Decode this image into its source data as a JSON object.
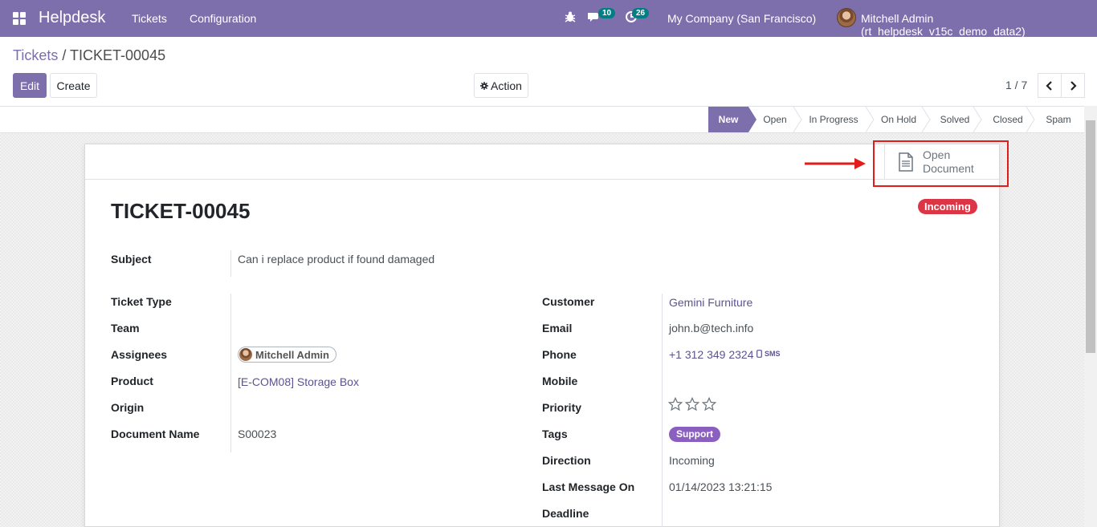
{
  "navbar": {
    "app_name": "Helpdesk",
    "menus": [
      "Tickets",
      "Configuration"
    ],
    "messages_count": "10",
    "activities_count": "26",
    "company": "My Company (San Francisco)",
    "user": "Mitchell Admin (rt_helpdesk_v15c_demo_data2)",
    "color": "#7C6FAB"
  },
  "control": {
    "breadcrumb_parent": "Tickets",
    "breadcrumb_sep": " / ",
    "breadcrumb_current": "TICKET-00045",
    "edit_label": "Edit",
    "create_label": "Create",
    "action_label": "Action",
    "pager": "1 / 7"
  },
  "stages": [
    {
      "label": "New",
      "active": true
    },
    {
      "label": "Open",
      "active": false
    },
    {
      "label": "In Progress",
      "active": false
    },
    {
      "label": "On Hold",
      "active": false
    },
    {
      "label": "Solved",
      "active": false
    },
    {
      "label": "Closed",
      "active": false
    },
    {
      "label": "Spam",
      "active": false
    }
  ],
  "smart_button": {
    "line1": "Open",
    "line2": "Document",
    "icon": "document-icon"
  },
  "form": {
    "title": "TICKET-00045",
    "direction_badge": "Incoming",
    "subject_label": "Subject",
    "subject_value": "Can i replace product if found damaged",
    "left": [
      {
        "label": "Ticket Type",
        "value": ""
      },
      {
        "label": "Team",
        "value": ""
      },
      {
        "label": "Assignees",
        "value": "Mitchell Admin"
      },
      {
        "label": "Product",
        "value": "[E-COM08] Storage Box"
      },
      {
        "label": "Origin",
        "value": ""
      },
      {
        "label": "Document Name",
        "value": "S00023"
      }
    ],
    "right": [
      {
        "label": "Customer",
        "value": "Gemini Furniture"
      },
      {
        "label": "Email",
        "value": "john.b@tech.info"
      },
      {
        "label": "Phone",
        "value": "+1 312 349 2324"
      },
      {
        "label": "Mobile",
        "value": ""
      },
      {
        "label": "Priority",
        "value": ""
      },
      {
        "label": "Tags",
        "value": "Support"
      },
      {
        "label": "Direction",
        "value": "Incoming"
      },
      {
        "label": "Last Message On",
        "value": "01/14/2023 13:21:15"
      },
      {
        "label": "Deadline",
        "value": ""
      }
    ],
    "sms_label": "SMS",
    "priority_stars": 0,
    "priority_max": 3
  }
}
